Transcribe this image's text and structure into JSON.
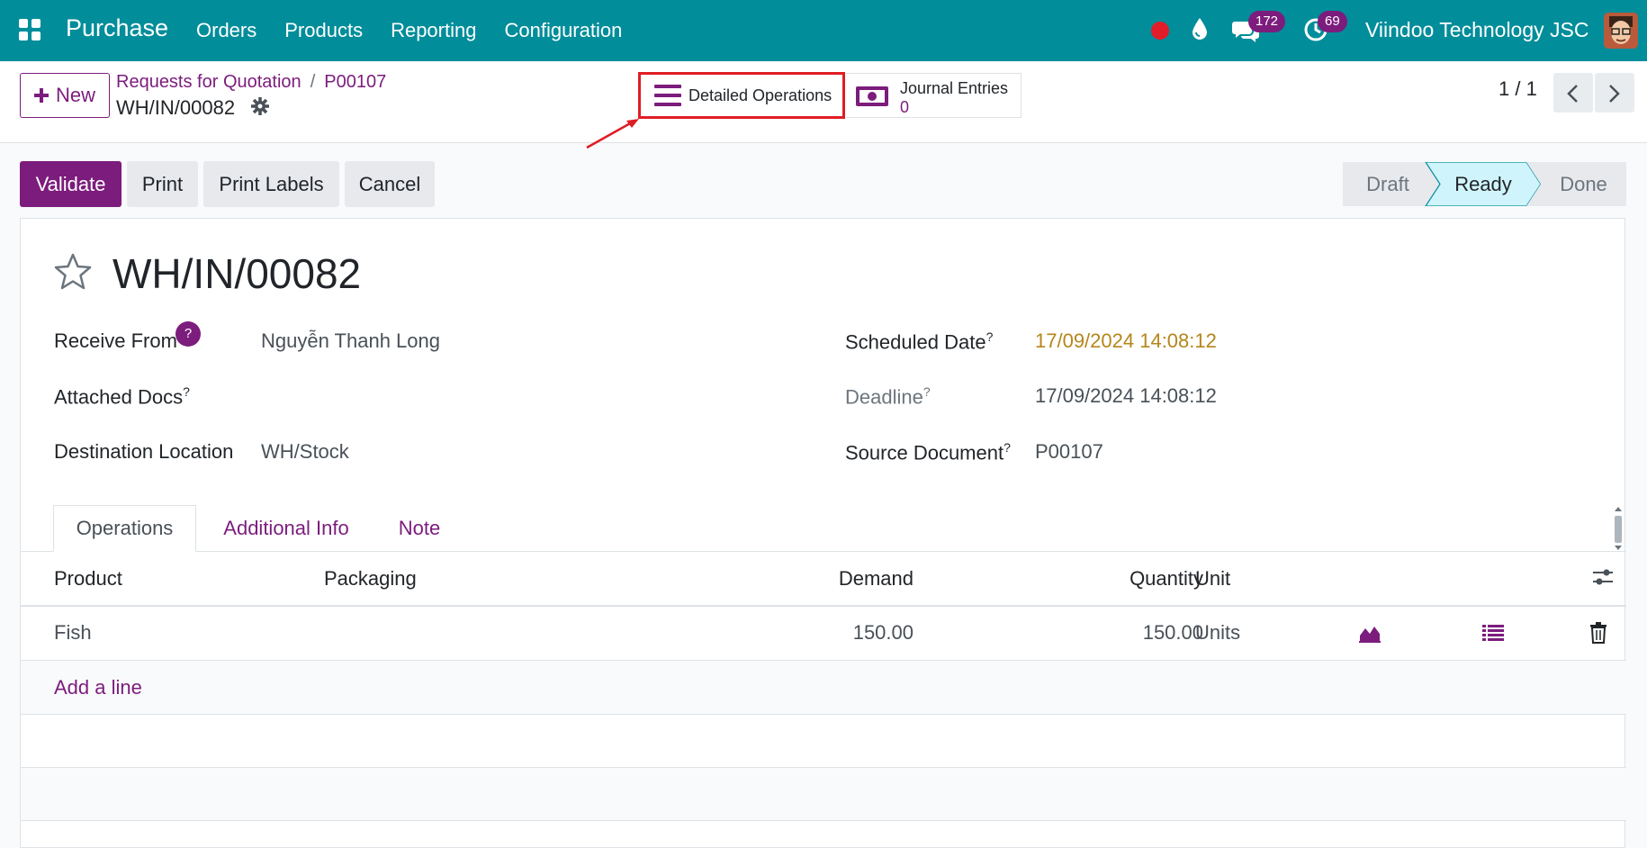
{
  "navbar": {
    "app_name": "Purchase",
    "menu": [
      "Orders",
      "Products",
      "Reporting",
      "Configuration"
    ],
    "messages_count": "172",
    "activities_count": "69",
    "company": "Viindoo Technology JSC",
    "bg_color": "#018d9a"
  },
  "control_panel": {
    "new_label": "New",
    "breadcrumb": [
      "Requests for Quotation",
      "P00107"
    ],
    "record_name": "WH/IN/00082",
    "smart_buttons": {
      "detailed_operations": "Detailed Operations",
      "journal_entries_label": "Journal Entries",
      "journal_entries_count": "0"
    },
    "pager": "1 / 1"
  },
  "actions": {
    "validate": "Validate",
    "print": "Print",
    "print_labels": "Print Labels",
    "cancel": "Cancel"
  },
  "statusbar": {
    "stages": [
      "Draft",
      "Ready",
      "Done"
    ],
    "current": "Ready"
  },
  "form": {
    "title": "WH/IN/00082",
    "fields": {
      "receive_from_label": "Receive From",
      "receive_from_help": "?",
      "receive_from_value": "Nguyễn Thanh Long",
      "attached_docs_label": "Attached Docs",
      "destination_label": "Destination Location",
      "destination_value": "WH/Stock",
      "scheduled_date_label": "Scheduled Date",
      "scheduled_date_value": "17/09/2024 14:08:12",
      "deadline_label": "Deadline",
      "deadline_value": "17/09/2024 14:08:12",
      "source_doc_label": "Source Document",
      "source_doc_value": "P00107",
      "help_mark": "?"
    },
    "tabs": [
      "Operations",
      "Additional Info",
      "Note"
    ],
    "table": {
      "columns": [
        "Product",
        "Packaging",
        "Demand",
        "Quantity",
        "Unit"
      ],
      "rows": [
        {
          "product": "Fish",
          "packaging": "",
          "demand": "150.00",
          "quantity": "150.00",
          "unit": "Units"
        }
      ],
      "add_line": "Add a line"
    }
  },
  "colors": {
    "accent": "#7c1c7d",
    "scheduled_date": "#b5861a",
    "highlight_box": "#e01d24",
    "ready_stage_bg": "#cff4fc"
  }
}
